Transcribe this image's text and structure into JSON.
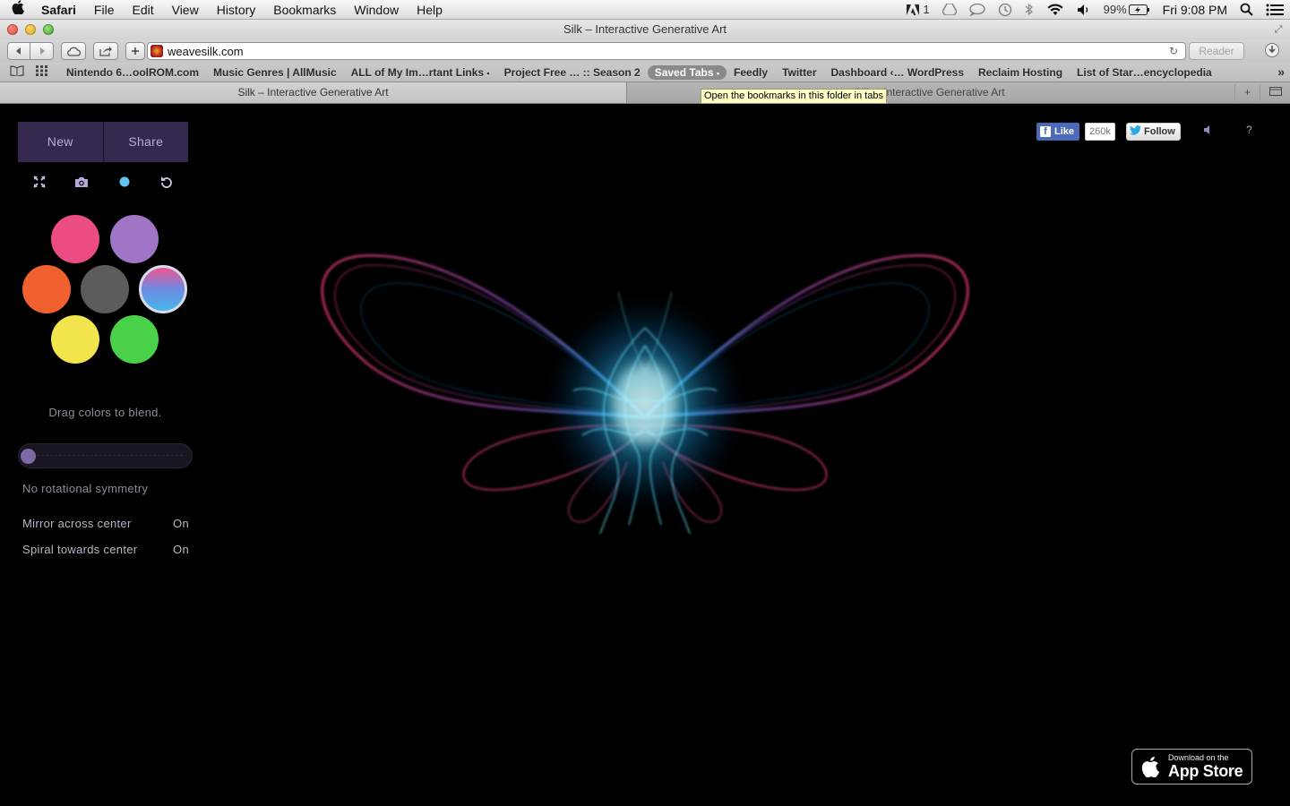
{
  "menubar": {
    "apple": "",
    "app_name": "Safari",
    "items": [
      "File",
      "Edit",
      "View",
      "History",
      "Bookmarks",
      "Window",
      "Help"
    ],
    "status": {
      "adobe_count": "1",
      "battery": "99%",
      "clock": "Fri 9:08 PM"
    }
  },
  "window": {
    "title": "Silk – Interactive Generative Art"
  },
  "toolbar": {
    "url": "weavesilk.com",
    "reader_label": "Reader"
  },
  "bookmarks": {
    "items": [
      "Nintendo 6…oolROM.com",
      "Music Genres | AllMusic",
      "ALL of My Im…rtant Links",
      "Project Free … :: Season 2",
      "Saved Tabs",
      "Feedly",
      "Twitter",
      "Dashboard ‹… WordPress",
      "Reclaim Hosting",
      "List of Star…encyclopedia"
    ],
    "more": "»"
  },
  "tabs": {
    "tab1": "Silk – Interactive Generative Art",
    "tab2": "Silk – Interactive Generative Art"
  },
  "tooltip": "Open the bookmarks in this folder in tabs",
  "sidebar": {
    "new_label": "New",
    "share_label": "Share",
    "blend_hint": "Drag colors to blend.",
    "symmetry_label": "No rotational symmetry",
    "symmetry_level": 0,
    "mirror_label": "Mirror across center",
    "mirror_value": "On",
    "spiral_label": "Spiral towards center",
    "spiral_value": "On",
    "colors": {
      "pink": "#ec4c84",
      "purple": "#a075c6",
      "orange": "#f1602f",
      "gray": "#5c5c5c",
      "yellow": "#f2e44d",
      "green": "#4ad14a",
      "selected": "gradient"
    }
  },
  "social": {
    "like_label": "Like",
    "like_count": "260k",
    "follow_label": "Follow",
    "help": "?"
  },
  "appstore": {
    "small": "Download on the",
    "large": "App Store"
  },
  "icons": [
    "apple-icon",
    "fullscreen-icon",
    "camera-icon",
    "color-dot-icon",
    "undo-icon",
    "speaker-icon"
  ]
}
